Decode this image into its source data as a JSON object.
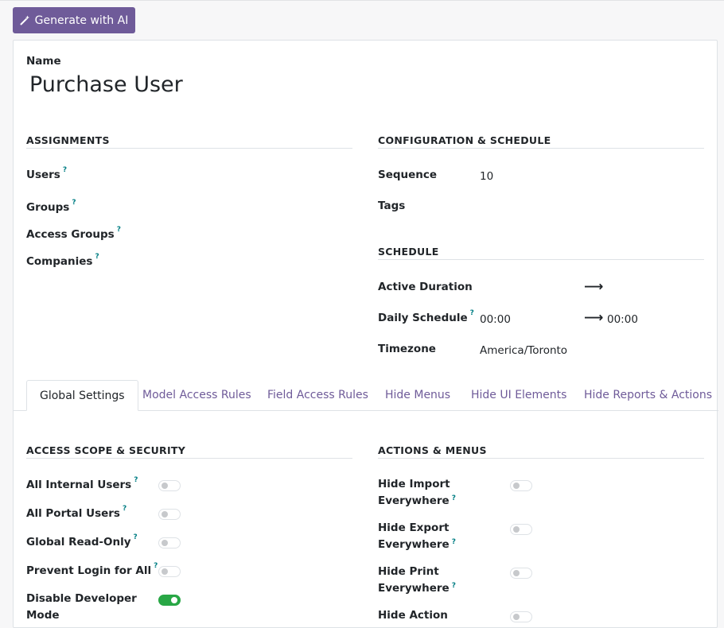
{
  "ai_button": {
    "label": "Generate with AI",
    "icon": "magic-wand-icon"
  },
  "name": {
    "label": "Name",
    "value": "Purchase User"
  },
  "assignments": {
    "title": "ASSIGNMENTS",
    "users": "Users",
    "groups": "Groups",
    "access_groups": "Access Groups",
    "companies": "Companies"
  },
  "config": {
    "title": "CONFIGURATION & SCHEDULE",
    "sequence_label": "Sequence",
    "sequence_value": "10",
    "tags_label": "Tags"
  },
  "schedule": {
    "title": "SCHEDULE",
    "active_duration_label": "Active Duration",
    "daily_schedule_label": "Daily Schedule",
    "daily_from": "00:00",
    "daily_to": "00:00",
    "timezone_label": "Timezone",
    "timezone_value": "America/Toronto"
  },
  "help_mark": "?",
  "arrow": "⟶",
  "tabs": [
    {
      "label": "Global Settings",
      "active": true
    },
    {
      "label": "Model Access Rules"
    },
    {
      "label": "Field Access Rules"
    },
    {
      "label": "Hide Menus"
    },
    {
      "label": "Hide UI Elements"
    },
    {
      "label": "Hide Reports & Actions"
    }
  ],
  "access_scope": {
    "title": "ACCESS SCOPE & SECURITY",
    "all_internal_users": {
      "label": "All Internal Users",
      "on": false
    },
    "all_portal_users": {
      "label": "All Portal Users",
      "on": false
    },
    "global_read_only": {
      "label": "Global Read-Only",
      "on": false
    },
    "prevent_login": {
      "label": "Prevent Login for All",
      "on": false
    },
    "disable_dev_mode": {
      "label_1": "Disable Developer",
      "label_2": "Mode",
      "on": true
    }
  },
  "actions_menus": {
    "title": "ACTIONS & MENUS",
    "hide_import": {
      "label_1": "Hide Import",
      "label_2": "Everywhere",
      "on": false
    },
    "hide_export": {
      "label_1": "Hide Export",
      "label_2": "Everywhere",
      "on": false
    },
    "hide_print": {
      "label_1": "Hide Print",
      "label_2": "Everywhere",
      "on": false
    },
    "hide_action": {
      "label_1": "Hide Action",
      "on": false
    }
  },
  "colors": {
    "brand": "#6f5b99",
    "toggle_on": "#28a745",
    "help": "#017e84"
  }
}
